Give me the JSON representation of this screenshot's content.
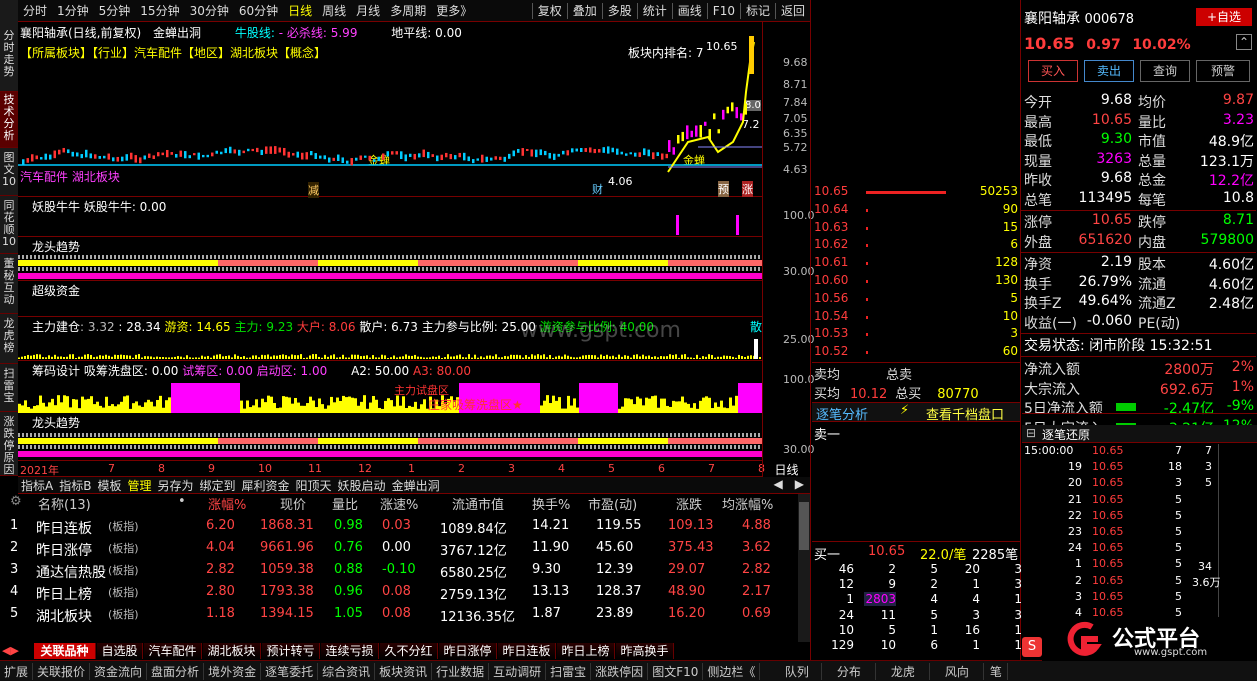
{
  "sidetabs": [
    "分时走势",
    "技术分析",
    "图文10",
    "同花顺10",
    "董秘互动",
    "龙虎榜",
    "扫雷宝",
    "涨跌停原因"
  ],
  "menu": [
    "分时",
    "1分钟",
    "5分钟",
    "15分钟",
    "30分钟",
    "60分钟",
    "日线",
    "周线",
    "月线",
    "多周期",
    "更多》"
  ],
  "menu_right": [
    "复权",
    "叠加",
    "多股",
    "统计",
    "画线",
    "F10",
    "标记",
    "返回"
  ],
  "chart_header": {
    "title": "襄阳轴承(日线,前复权)",
    "indicator": "金蝉出洞",
    "niu": "牛股线:",
    "must": "- 必杀线: 5.99",
    "dipin": "地平线: 0.00"
  },
  "tags": "【所属板块】【行业】汽车配件【地区】湖北板块【概念】",
  "rank": "板块内排名: 7",
  "price_label": "10.65",
  "bottom_tag": "汽车配件 湖北板块",
  "markers": {
    "jinchan1": "金蝉",
    "jinchan2": "金蝉",
    "jian": "减",
    "cai": "财",
    "low": "4.06",
    "yu": "预",
    "zhang": "涨",
    "m80": "8.0",
    "m72": "7.2"
  },
  "main_axis": [
    "9.68",
    "8.71",
    "7.84",
    "7.05",
    "6.35",
    "5.72",
    "4.63"
  ],
  "p1": {
    "label": "妖股牛牛  妖股牛牛: 0.00",
    "axis": "100.0"
  },
  "p2": {
    "label": "龙头趋势",
    "axis": "30.00"
  },
  "p3": {
    "label": "超级资金"
  },
  "p4": {
    "label": "主力建仓",
    "v1": ": 3.32",
    "v2": ": 28.34",
    "yz": "游资: 14.65",
    "zl": "主力: 9.23",
    "dh": "大户: 8.06",
    "sh": "散户: 6.73",
    "bl": "主力参与比例: 25.00",
    "ys": "游资参与比例: 40.00",
    "ax": "25.00",
    "san": "散"
  },
  "p5": {
    "label": "筹码设计",
    "xc": "吸筹洗盘区: 0.00",
    "sp": "试筹区: 0.00",
    "qd": "启动区: 1.00",
    "a2": "A2: 50.00",
    "a3": "A3: 80.00",
    "axis": "100.0",
    "zone": "庄家吸筹洗盘区★",
    "zone2": "主力试盘区"
  },
  "p6": {
    "label": "龙头趋势",
    "axis": "30.00"
  },
  "xaxis": {
    "year": "2021年",
    "months": [
      "7",
      "8",
      "9",
      "10",
      "11",
      "12",
      "1",
      "2",
      "3",
      "4",
      "5",
      "6",
      "7",
      "8"
    ],
    "period": "日线"
  },
  "toolbar": [
    "指标A",
    "指标B",
    "模板",
    "管理",
    "另存为",
    "绑定到",
    "犀利资金",
    "阳顶天",
    "妖股启动",
    "金蝉出洞"
  ],
  "table": {
    "headers": [
      "名称(13)",
      "•",
      "涨幅%",
      "现价",
      "量比",
      "涨速%",
      "流通市值",
      "换手%",
      "市盈(动)",
      "涨跌",
      "均涨幅%"
    ],
    "rows": [
      [
        "1",
        "昨日连板",
        "(板指)",
        "6.20",
        "1868.31",
        "0.98",
        "0.03",
        "1089.84亿",
        "14.21",
        "119.55",
        "109.13",
        "4.88"
      ],
      [
        "2",
        "昨日涨停",
        "(板指)",
        "4.04",
        "9661.96",
        "0.76",
        "0.00",
        "3767.12亿",
        "11.90",
        "45.60",
        "375.43",
        "3.62"
      ],
      [
        "3",
        "通达信热股",
        "(板指)",
        "2.82",
        "1059.38",
        "0.88",
        "-0.10",
        "6580.25亿",
        "9.30",
        "12.39",
        "29.07",
        "2.82"
      ],
      [
        "4",
        "昨日上榜",
        "(板指)",
        "2.80",
        "1793.38",
        "0.96",
        "0.08",
        "2759.13亿",
        "13.13",
        "128.37",
        "48.90",
        "2.17"
      ],
      [
        "5",
        "湖北板块",
        "(板指)",
        "1.18",
        "1394.15",
        "1.05",
        "0.08",
        "12136.35亿",
        "1.87",
        "23.89",
        "16.20",
        "0.69"
      ]
    ]
  },
  "bottom_tabs": [
    "关联品种",
    "自选股",
    "汽车配件",
    "湖北板块",
    "预计转亏",
    "连续亏损",
    "久不分红",
    "昨日涨停",
    "昨日连板",
    "昨日上榜",
    "昨高换手"
  ],
  "status": [
    "扩展",
    "关联报价",
    "资金流向",
    "盘面分析",
    "境外资金",
    "逐笔委托",
    "综合资讯",
    "板块资讯",
    "行业数据",
    "互动调研",
    "扫雷宝",
    "涨跌停因",
    "图文F10",
    "侧边栏《"
  ],
  "status_right": [
    "队列",
    "分布",
    "龙虎",
    "风向",
    "笔"
  ],
  "stock": {
    "name": "襄阳轴承",
    "code": "000678",
    "add": "+自选",
    "price": "10.65",
    "chg": "0.97",
    "pct": "10.02%"
  },
  "actions": [
    "买入",
    "卖出",
    "查询",
    "预警"
  ],
  "quote": [
    [
      "今开",
      "9.68",
      "均价",
      "9.87"
    ],
    [
      "最高",
      "10.65",
      "量比",
      "3.23"
    ],
    [
      "最低",
      "9.30",
      "市值",
      "48.9亿"
    ],
    [
      "现量",
      "3263",
      "总量",
      "123.1万"
    ],
    [
      "昨收",
      "9.68",
      "总金",
      "12.2亿"
    ],
    [
      "总笔",
      "113495",
      "每笔",
      "10.8"
    ]
  ],
  "quote2": [
    [
      "涨停",
      "10.65",
      "跌停",
      "8.71"
    ],
    [
      "外盘",
      "651620",
      "内盘",
      "579800"
    ]
  ],
  "quote3": [
    [
      "净资",
      "2.19",
      "股本",
      "4.60亿"
    ],
    [
      "换手",
      "26.79%",
      "流通",
      "4.60亿"
    ],
    [
      "换手Z",
      "49.64%",
      "流通Z",
      "2.48亿"
    ],
    [
      "收益(一)",
      "-0.060",
      "PE(动)",
      ""
    ]
  ],
  "trade_state": "交易状态: 闭市阶段 15:32:51",
  "flows": [
    [
      "净流入额",
      "2800万",
      "2%"
    ],
    [
      "大宗流入",
      "692.6万",
      "1%"
    ],
    [
      "5日净流入额",
      "-2.47亿",
      "-9%"
    ],
    [
      "5日大宗流入",
      "-3.21亿",
      "-12%"
    ]
  ],
  "asks": [
    [
      "10.65",
      "50253"
    ],
    [
      "10.64",
      "90"
    ],
    [
      "10.63",
      "15"
    ],
    [
      "10.62",
      "6"
    ],
    [
      "10.61",
      "128"
    ],
    [
      "10.60",
      "130"
    ],
    [
      "10.56",
      "5"
    ],
    [
      "10.54",
      "10"
    ],
    [
      "10.53",
      "3"
    ],
    [
      "10.52",
      "60"
    ]
  ],
  "summary": {
    "mj": "卖均",
    "zm": "总卖",
    "bj": "买均",
    "bjv": "10.12",
    "zb": "总买",
    "zbv": "80770",
    "zbfx": "逐笔分析",
    "qd": "查看千档盘口",
    "maiyi": "卖一"
  },
  "buy1": {
    "label": "买一",
    "price": "10.65",
    "qty": "22.0/笔",
    "cnt": "2285笔"
  },
  "queue": [
    [
      "46",
      "2",
      "5",
      "20",
      "3"
    ],
    [
      "12",
      "9",
      "2",
      "1",
      "3"
    ],
    [
      "1",
      "2803",
      "4",
      "4",
      "1"
    ],
    [
      "24",
      "11",
      "5",
      "3",
      "3"
    ],
    [
      "10",
      "5",
      "1",
      "16",
      "1"
    ],
    [
      "129",
      "10",
      "6",
      "1",
      "1"
    ]
  ],
  "ticks": {
    "title": "逐笔还原",
    "first_time": "15:00:00",
    "rows": [
      [
        "19",
        "10.65",
        "18",
        "3"
      ],
      [
        "20",
        "10.65",
        "3",
        "5"
      ],
      [
        "21",
        "10.65",
        "5",
        ""
      ],
      [
        "22",
        "10.65",
        "5",
        ""
      ],
      [
        "23",
        "10.65",
        "5",
        ""
      ],
      [
        "24",
        "10.65",
        "5",
        ""
      ],
      [
        "1",
        "10.65",
        "5",
        ""
      ],
      [
        "2",
        "10.65",
        "5",
        ""
      ],
      [
        "3",
        "10.65",
        "5",
        ""
      ],
      [
        "4",
        "10.65",
        "5",
        ""
      ],
      [
        "5",
        "10.65",
        "3",
        ""
      ]
    ],
    "first": [
      "10.65",
      "7",
      "7"
    ],
    "side1": "34",
    "side2": "3.6万"
  },
  "watermark": "www.gspt.com",
  "logo": "公式平台",
  "logo_url": "www.gspt.com"
}
